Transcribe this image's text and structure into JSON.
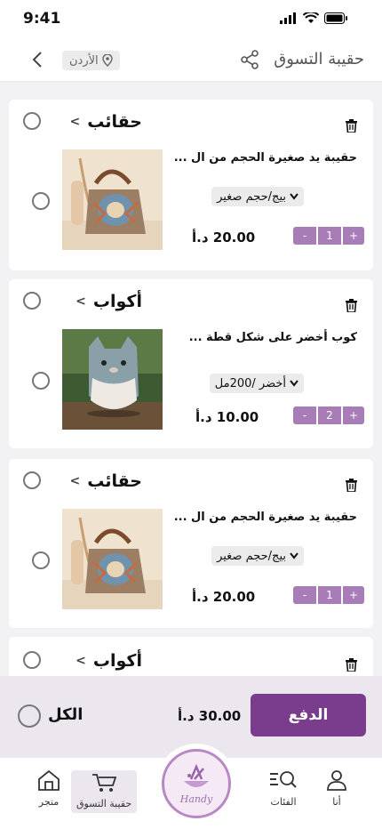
{
  "status": {
    "time": "9:41"
  },
  "header": {
    "title": "حقيبة التسوق",
    "location": "الأردن"
  },
  "cards": [
    {
      "store": "حقائب",
      "name": "حقيبة يد صغيرة الحجم من ال ...",
      "variant": "بيج/حجم صغير",
      "price": "20.00 د.أ",
      "qty": "1",
      "image": "bag"
    },
    {
      "store": "أكواب",
      "name": "كوب أخضر على شكل قطة ...",
      "variant": "أخضر /200مل",
      "price": "10.00 د.أ",
      "qty": "2",
      "image": "cup"
    },
    {
      "store": "حقائب",
      "name": "حقيبة يد صغيرة الحجم من ال ...",
      "variant": "بيج/حجم صغير",
      "price": "20.00 د.أ",
      "qty": "1",
      "image": "bag"
    },
    {
      "store": "أكواب"
    }
  ],
  "qty_controls": {
    "minus": "-",
    "plus": "+"
  },
  "checkout": {
    "all_label": "الكل",
    "total": "30.00 د.أ",
    "pay_label": "الدفع"
  },
  "nav": {
    "me": "أنا",
    "categories": "الفئات",
    "cart": "حقيبة التسوق",
    "store": "متجر",
    "logo_text": "Handy"
  },
  "colors": {
    "accent": "#7a3c8c",
    "qty_bg": "#a77cb7",
    "checkout_bg": "#ece6ef"
  }
}
